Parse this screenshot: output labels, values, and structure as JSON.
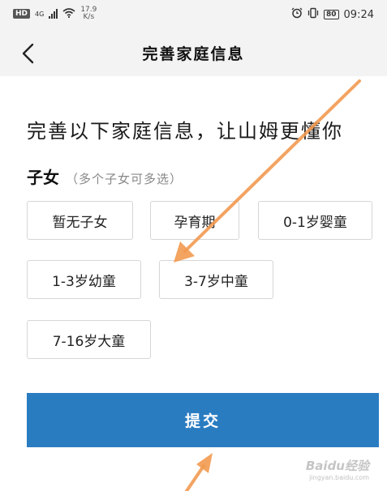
{
  "status_bar": {
    "hd": "HD",
    "network": "4G",
    "speed_value": "17.9",
    "speed_unit": "K/s",
    "battery": "80",
    "time": "09:24",
    "icons": [
      "signal-icon",
      "wifi-icon",
      "alarm-icon",
      "vibrate-icon",
      "battery-icon"
    ]
  },
  "header": {
    "title": "完善家庭信息",
    "back_icon": "chevron-left-icon"
  },
  "main": {
    "headline": "完善以下家庭信息，让山姆更懂你",
    "section_title": "子女",
    "section_hint": "（多个子女可多选）",
    "options": [
      "暂无子女",
      "孕育期",
      "0-1岁婴童",
      "1-3岁幼童",
      "3-7岁中童",
      "7-16岁大童"
    ]
  },
  "submit": {
    "label": "提交"
  },
  "watermark": {
    "text": "Baidu经验",
    "sub": "jingyan.baidu.com"
  },
  "colors": {
    "accent": "#2a7cc1",
    "annotation_arrow": "#f29a50",
    "status_bg": "#f3f3f3"
  }
}
